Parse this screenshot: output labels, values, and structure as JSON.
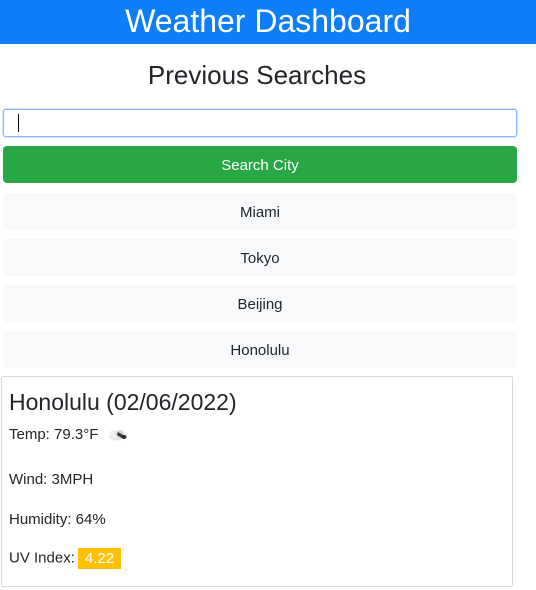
{
  "header": {
    "title": "Weather Dashboard"
  },
  "sidebar": {
    "subtitle": "Previous Searches",
    "search_input": {
      "value": "",
      "placeholder": ""
    },
    "search_button_label": "Search City",
    "history": [
      {
        "label": "Miami"
      },
      {
        "label": "Tokyo"
      },
      {
        "label": "Beijing"
      },
      {
        "label": "Honolulu"
      }
    ]
  },
  "current": {
    "title": "Honolulu (02/06/2022)",
    "temp": "Temp: 79.3°F",
    "weather_icon": "partly-cloudy-icon",
    "wind": "Wind: 3MPH",
    "humidity": "Humidity: 64%",
    "uv_label": "UV Index:",
    "uv_value": "4.22",
    "uv_color": "#ffc107"
  }
}
